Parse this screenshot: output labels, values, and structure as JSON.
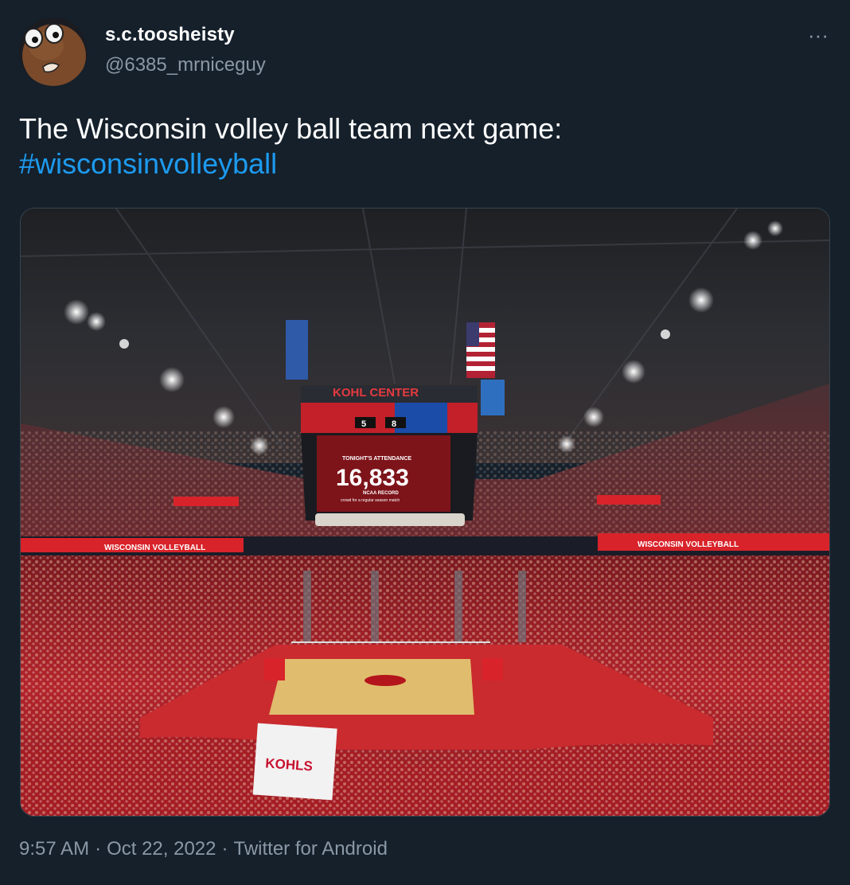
{
  "author": {
    "display_name": "s.c.toosheisty",
    "handle": "@6385_mrniceguy",
    "avatar_icon": "cartoon-face-avatar"
  },
  "more_button": {
    "icon": "more-horizontal-icon",
    "label": "···"
  },
  "tweet": {
    "text": "The Wisconsin volley ball team next game:",
    "hashtag": "#wisconsinvolleyball"
  },
  "media": {
    "arena_name": "KOHL CENTER",
    "attendance_label": "TONIGHT'S ATTENDANCE",
    "attendance_value": "16,833",
    "record_label": "NCAA RECORD",
    "record_sub": "crowd for a regular season match",
    "score_home": "5",
    "score_away": "8",
    "ribbon_left": "WISCONSIN VOLLEYBALL",
    "ribbon_right": "WISCONSIN VOLLEYBALL",
    "sign_text": "KOHLS"
  },
  "footer": {
    "time": "9:57 AM",
    "date": "Oct 22, 2022",
    "source": "Twitter for Android",
    "separator": "·"
  },
  "colors": {
    "background": "#15202b",
    "link": "#1d9bf0",
    "secondary_text": "#8b98a5",
    "arena_red": "#c8102e"
  }
}
